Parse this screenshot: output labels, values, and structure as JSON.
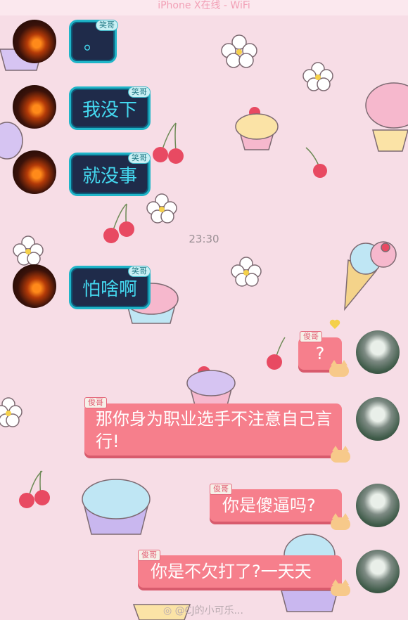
{
  "status_bar": {
    "text": "iPhone X在线 - WiFi"
  },
  "timestamp": "23:30",
  "left_tag": "笑哥",
  "right_tag": "俊哥",
  "messages": [
    {
      "side": "left",
      "text": "。"
    },
    {
      "side": "left",
      "text": "我没下"
    },
    {
      "side": "left",
      "text": "就没事"
    },
    {
      "side": "left",
      "text": "怕啥啊"
    },
    {
      "side": "right",
      "text": "?"
    },
    {
      "side": "right",
      "text": "那你身为职业选手不注意自己言行!"
    },
    {
      "side": "right",
      "text": "你是傻逼吗?"
    },
    {
      "side": "right",
      "text": "你是不欠打了?一天天"
    }
  ],
  "watermark": "@CJ的小可乐...",
  "colors": {
    "background": "#f7dde6",
    "left_bubble": "#1f2b4a",
    "left_text": "#44d8ef",
    "right_bubble": "#f67f8c"
  }
}
